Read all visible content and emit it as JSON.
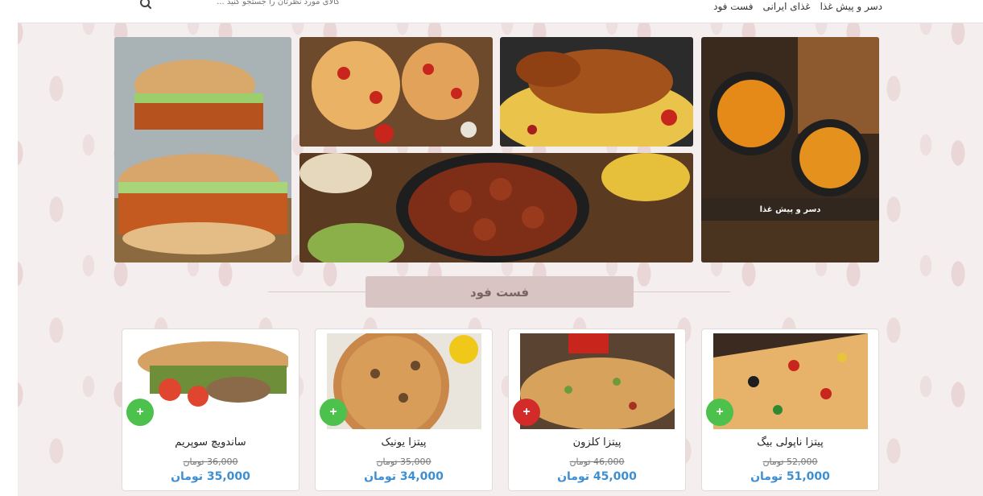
{
  "nav": {
    "items": [
      "فست فود",
      "غذای ایرانی",
      "دسر و پیش غذا"
    ]
  },
  "search": {
    "placeholder": "کالای مورد نظرتان را جستجو کنید ..."
  },
  "banner": {
    "caption": "دسر و پیش غذا"
  },
  "section": {
    "title": "فست فود"
  },
  "colors": {
    "price": "#3d8fd1",
    "add_green": "#4cc14c",
    "add_red": "#d32a2a",
    "section_bg": "#d9c4c4"
  },
  "products": [
    {
      "name": "پیتزا ناپولی بیگ",
      "old_price": "52,000 تومان",
      "new_price": "51,000 تومان",
      "add_color": "#4cc14c",
      "add_icon": "plus-icon"
    },
    {
      "name": "پیتزا کلزون",
      "old_price": "46,000 تومان",
      "new_price": "45,000 تومان",
      "add_color": "#d32a2a",
      "add_icon": "plus-icon"
    },
    {
      "name": "پیتزا یونیک",
      "old_price": "35,000 تومان",
      "new_price": "34,000 تومان",
      "add_color": "#4cc14c",
      "add_icon": "plus-icon"
    },
    {
      "name": "ساندویچ سوپریم",
      "old_price": "36,000 تومان",
      "new_price": "35,000 تومان",
      "add_color": "#4cc14c",
      "add_icon": "plus-icon"
    }
  ]
}
